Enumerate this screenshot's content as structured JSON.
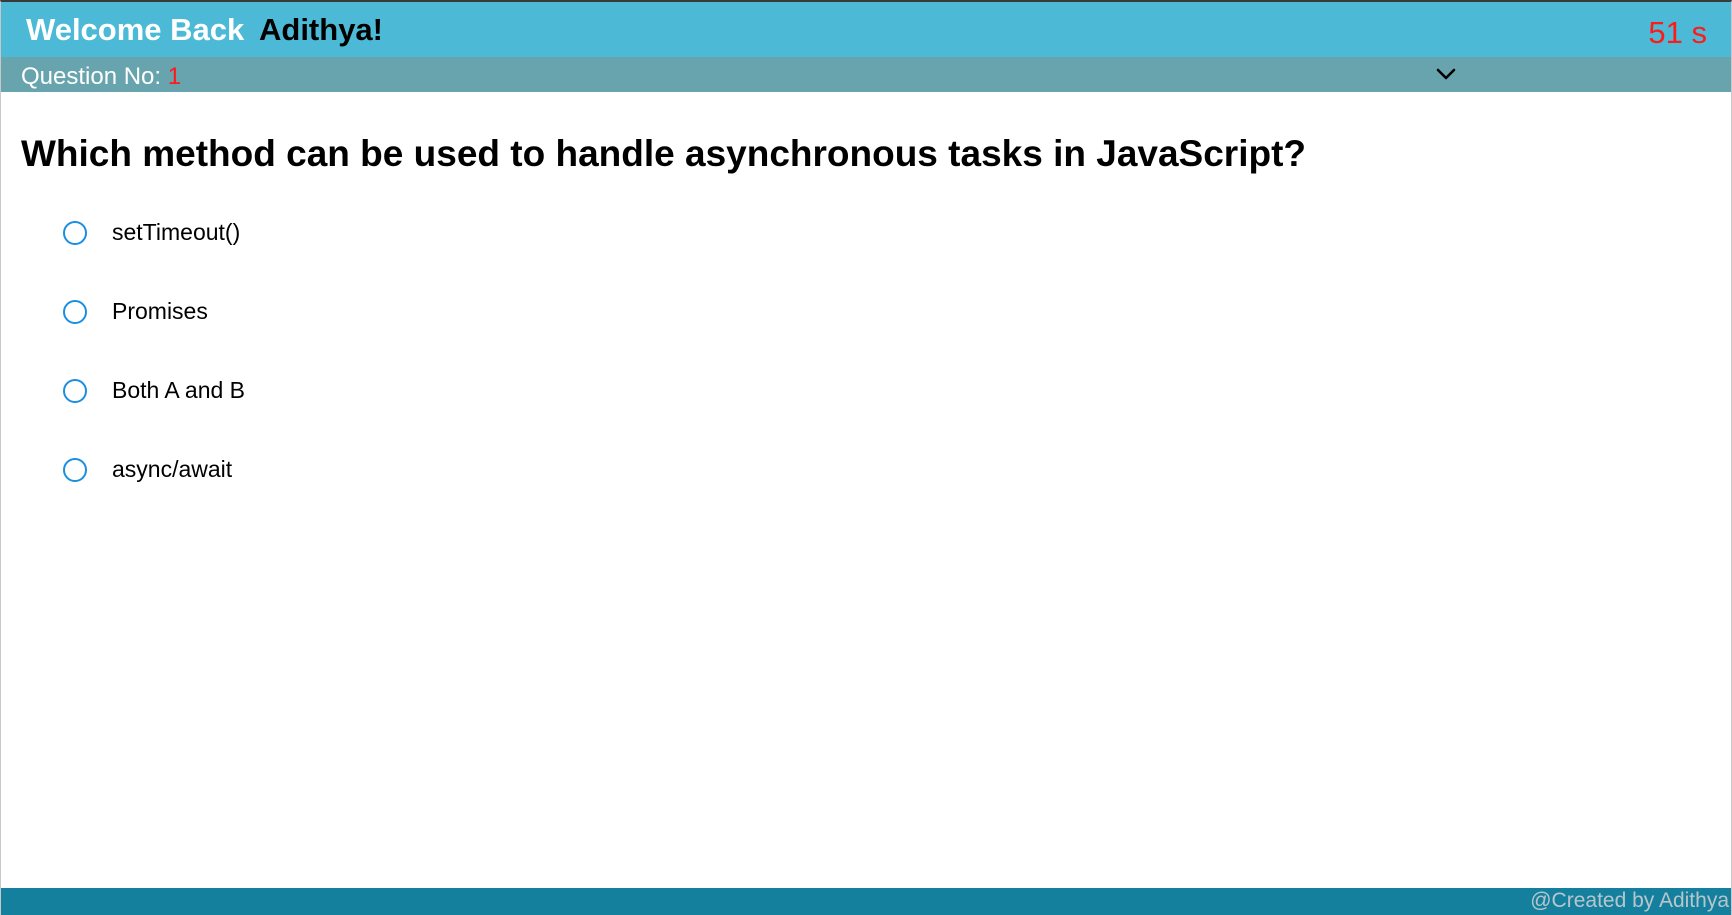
{
  "header": {
    "welcome_text": "Welcome Back",
    "username": "Adithya!",
    "timer": "51 s"
  },
  "question_bar": {
    "label": "Question No:",
    "number": "1",
    "expand_icon": "chevron-down-icon"
  },
  "question": {
    "text": "Which method can be used to handle asynchronous tasks in JavaScript?",
    "options": [
      {
        "label": "setTimeout()"
      },
      {
        "label": "Promises"
      },
      {
        "label": "Both A and B"
      },
      {
        "label": "async/await"
      }
    ]
  },
  "footer": {
    "credit": "@Created by Adithya"
  },
  "colors": {
    "header_bg": "#4cbad6",
    "question_bar_bg": "#68a4ad",
    "footer_bg": "#14809e",
    "timer": "#ff1a1a",
    "radio_border": "#1a8fe0"
  }
}
